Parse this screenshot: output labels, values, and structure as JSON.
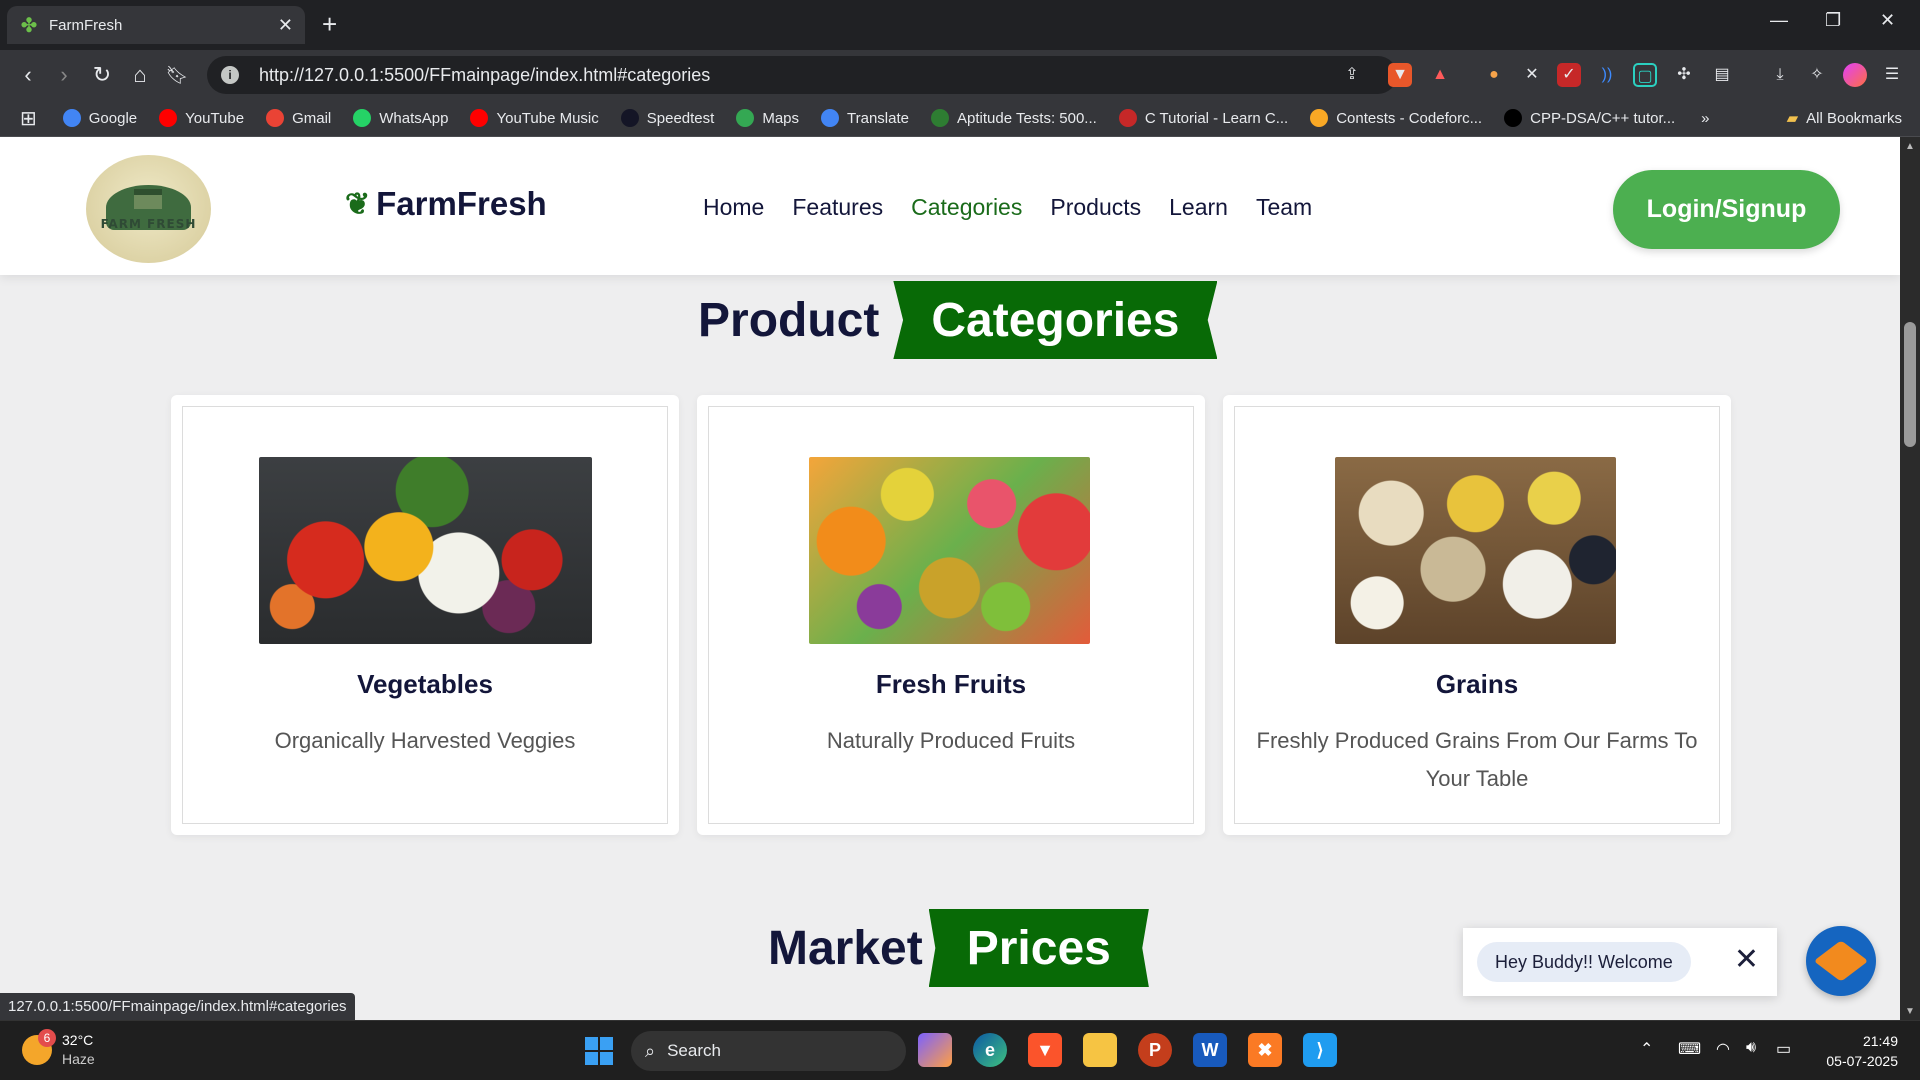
{
  "browser": {
    "tab_title": "FarmFresh",
    "url": "http://127.0.0.1:5500/FFmainpage/index.html#categories",
    "status_url": "127.0.0.1:5500/FFmainpage/index.html#categories",
    "bookmarks": [
      {
        "label": "Google",
        "icon": "google-icon",
        "color": "#4285f4"
      },
      {
        "label": "YouTube",
        "icon": "youtube-icon",
        "color": "#ff0000"
      },
      {
        "label": "Gmail",
        "icon": "gmail-icon",
        "color": "#ea4335"
      },
      {
        "label": "WhatsApp",
        "icon": "whatsapp-icon",
        "color": "#25d366"
      },
      {
        "label": "YouTube Music",
        "icon": "youtube-music-icon",
        "color": "#ff0000"
      },
      {
        "label": "Speedtest",
        "icon": "speedtest-icon",
        "color": "#141526"
      },
      {
        "label": "Maps",
        "icon": "maps-icon",
        "color": "#34a853"
      },
      {
        "label": "Translate",
        "icon": "translate-icon",
        "color": "#4285f4"
      },
      {
        "label": "Aptitude Tests: 500...",
        "icon": "check-icon",
        "color": "#2e7d32"
      },
      {
        "label": "C Tutorial - Learn C...",
        "icon": "cpp-icon",
        "color": "#c62828"
      },
      {
        "label": "Contests - Codeforc...",
        "icon": "codeforces-icon",
        "color": "#f9a825"
      },
      {
        "label": "CPP-DSA/C++ tutor...",
        "icon": "github-icon",
        "color": "#000000"
      }
    ],
    "all_bookmarks": "All Bookmarks"
  },
  "site": {
    "logo_text": "FARM FRESH",
    "brand": "FarmFresh",
    "nav": [
      "Home",
      "Features",
      "Categories",
      "Products",
      "Learn",
      "Team"
    ],
    "active_nav": "Categories",
    "login_label": "Login/Signup",
    "accent": "#086a06",
    "button_color": "#4caf50"
  },
  "categories_section": {
    "heading_plain": "Product",
    "heading_ribbon": "Categories",
    "cards": [
      {
        "title": "Vegetables",
        "desc": "Organically Harvested Veggies"
      },
      {
        "title": "Fresh Fruits",
        "desc": "Naturally Produced Fruits"
      },
      {
        "title": "Grains",
        "desc": "Freshly Produced Grains From Our Farms To Your Table"
      }
    ]
  },
  "market_section": {
    "heading_plain": "Market",
    "heading_ribbon": "Prices"
  },
  "chat": {
    "welcome": "Hey Buddy!! Welcome"
  },
  "taskbar": {
    "temperature": "32°C",
    "condition": "Haze",
    "notification_count": "6",
    "search_placeholder": "Search",
    "time": "21:49",
    "date": "05-07-2025"
  }
}
